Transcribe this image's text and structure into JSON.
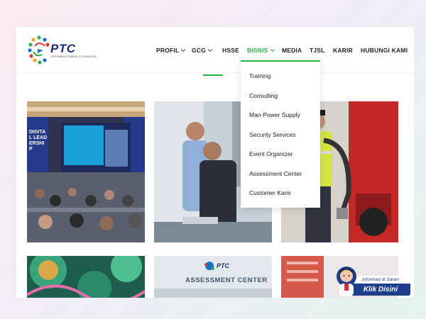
{
  "brand": {
    "name": "PTC",
    "tagline": "PERTAMINA TRAINING & CONSULTING"
  },
  "nav": {
    "items": [
      {
        "label": "PROFIL",
        "has_dropdown": true,
        "active": false
      },
      {
        "label": "GCG",
        "has_dropdown": true,
        "active": false
      },
      {
        "label": "HSSE",
        "has_dropdown": false,
        "active": false
      },
      {
        "label": "BISNIS",
        "has_dropdown": true,
        "active": true
      },
      {
        "label": "MEDIA",
        "has_dropdown": false,
        "active": false
      },
      {
        "label": "TJSL",
        "has_dropdown": false,
        "active": false
      },
      {
        "label": "KARIR",
        "has_dropdown": false,
        "active": false
      },
      {
        "label": "HUBUNGI KAMI",
        "has_dropdown": false,
        "active": false
      }
    ]
  },
  "bisnis_menu": {
    "items": [
      "Training",
      "Consulting",
      "Man-Power Supply",
      "Security Services",
      "Event Organizer",
      "Assessment Center",
      "Customer Kami"
    ]
  },
  "cards": {
    "c1": {
      "screen_title": "DIGITAL LEADERSHIP"
    },
    "c5": {
      "sign_brand": "PTC",
      "sign_text": "ASSESSMENT CENTER"
    }
  },
  "help_widget": {
    "caption": "Informasi & Saran",
    "button": "Klik Disini"
  },
  "colors": {
    "accent_green": "#2bb34a",
    "brand_navy": "#1d2f6f",
    "help_blue": "#1d3e8a"
  }
}
